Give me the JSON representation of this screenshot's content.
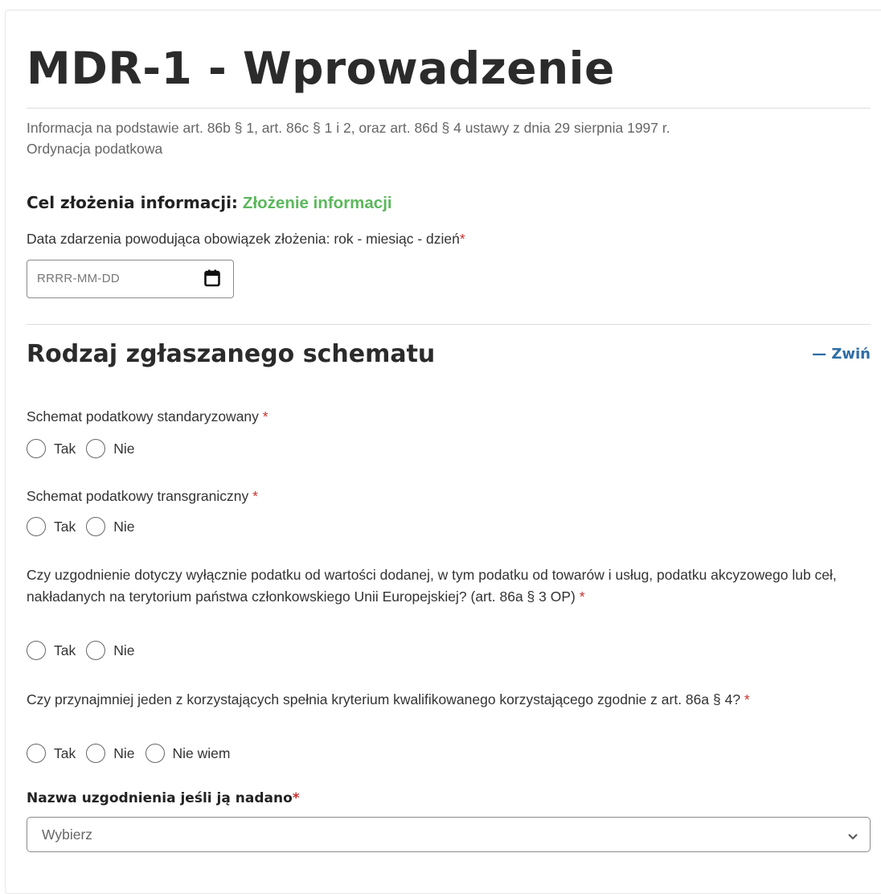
{
  "header": {
    "title": "MDR-1 - Wprowadzenie",
    "legal_line1": "Informacja na podstawie art. 86b § 1, art. 86c § 1 i 2, oraz art. 86d § 4 ustawy z dnia 29 sierpnia 1997 r.",
    "legal_line2": "Ordynacja podatkowa"
  },
  "purpose": {
    "label": "Cel złożenia informacji:",
    "value": "Złożenie informacji"
  },
  "event_date": {
    "label": "Data zdarzenia powodująca obowiązek złożenia: rok - miesiąc - dzień",
    "required_mark": "*",
    "placeholder": "RRRR-MM-DD",
    "icon": "calendar-icon"
  },
  "section": {
    "title": "Rodzaj zgłaszanego schematu",
    "collapse_label": "— Zwiń"
  },
  "questions": [
    {
      "label": "Schemat podatkowy standaryzowany",
      "required_mark": " *",
      "options": [
        "Tak",
        "Nie"
      ]
    },
    {
      "label": "Schemat podatkowy transgraniczny",
      "required_mark": " *",
      "options": [
        "Tak",
        "Nie"
      ]
    },
    {
      "label": "Czy uzgodnienie dotyczy wyłącznie podatku od wartości dodanej, w tym podatku od towarów i usług, podatku akcyzowego lub ceł, nakładanych na terytorium państwa członkowskiego Unii Europejskiej? (art. 86a § 3 OP)",
      "required_mark": " *",
      "options": [
        "Tak",
        "Nie"
      ]
    },
    {
      "label": "Czy przynajmniej jeden z korzystających spełnia kryterium kwalifikowanego korzystającego zgodnie z art. 86a § 4?",
      "required_mark": " *",
      "options": [
        "Tak",
        "Nie",
        "Nie wiem"
      ]
    }
  ],
  "arrangement_name": {
    "label": "Nazwa uzgodnienia jeśli ją nadano",
    "required_mark": "*",
    "selected": "Wybierz",
    "icon": "chevron-down-icon"
  },
  "colors": {
    "accent_green": "#5cb85c",
    "link_blue": "#2e6da4",
    "required_red": "#c9302c"
  }
}
